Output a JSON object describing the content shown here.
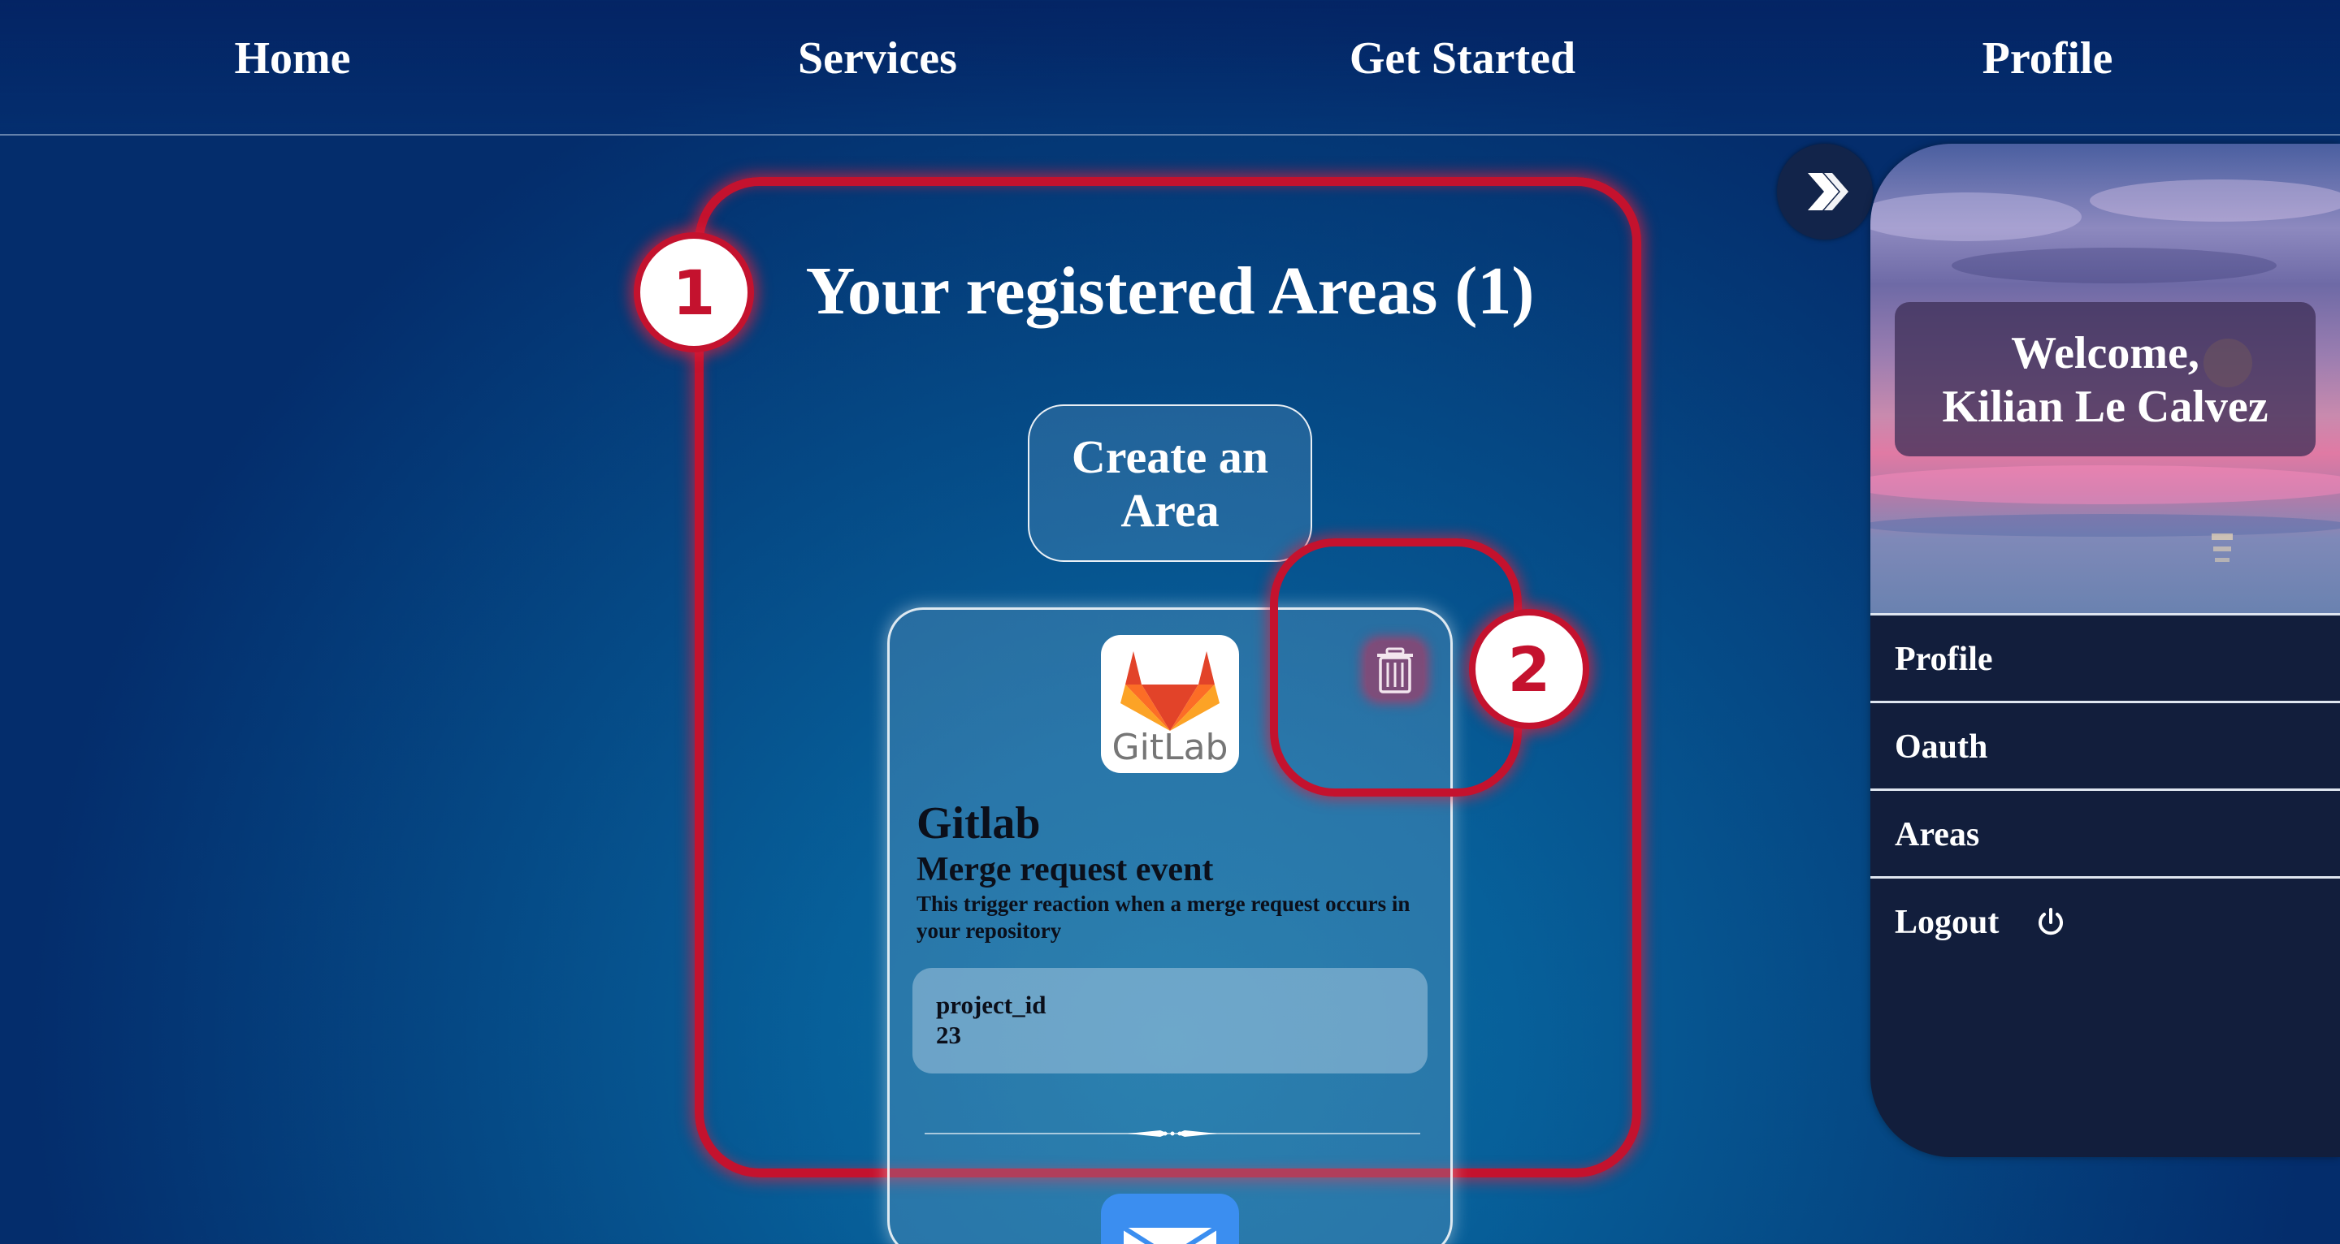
{
  "nav": {
    "items": [
      "Home",
      "Services",
      "Get Started",
      "Profile"
    ]
  },
  "areas": {
    "title": "Your registered Areas (1)",
    "create_button": "Create an Area",
    "badges": [
      "1",
      "2"
    ]
  },
  "card": {
    "logo_text": "GitLab",
    "service": "Gitlab",
    "event": "Merge request event",
    "description": "This trigger reaction when a merge request occurs in your repository",
    "param_key": "project_id",
    "param_value": "23"
  },
  "sidebar": {
    "welcome_line1": "Welcome,",
    "welcome_line2": "Kilian Le Calvez",
    "items": [
      "Profile",
      "Oauth",
      "Areas",
      "Logout"
    ]
  },
  "colors": {
    "highlight": "#c4122e",
    "sidebar_bg": "#121e3c",
    "page_bg": "#07609a"
  },
  "icons": {
    "expand": "double-chevron-right-icon",
    "delete": "trash-icon",
    "logout": "power-icon",
    "gitlab": "gitlab-icon",
    "mail": "mail-icon"
  }
}
